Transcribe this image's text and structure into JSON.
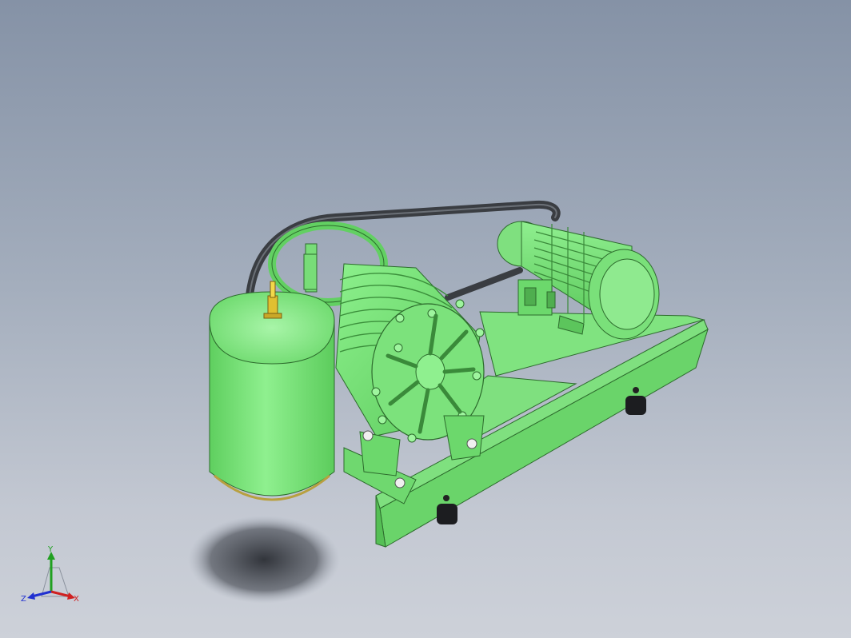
{
  "viewport": {
    "background_top": "#8592a6",
    "background_bottom": "#cdd1d9",
    "model_color": "#7fe07f",
    "belt_color": "#3a3d42"
  },
  "triad": {
    "x_label": "X",
    "y_label": "Y",
    "z_label": "Z",
    "x_color": "#d02020",
    "y_color": "#20a020",
    "z_color": "#2030d0"
  }
}
